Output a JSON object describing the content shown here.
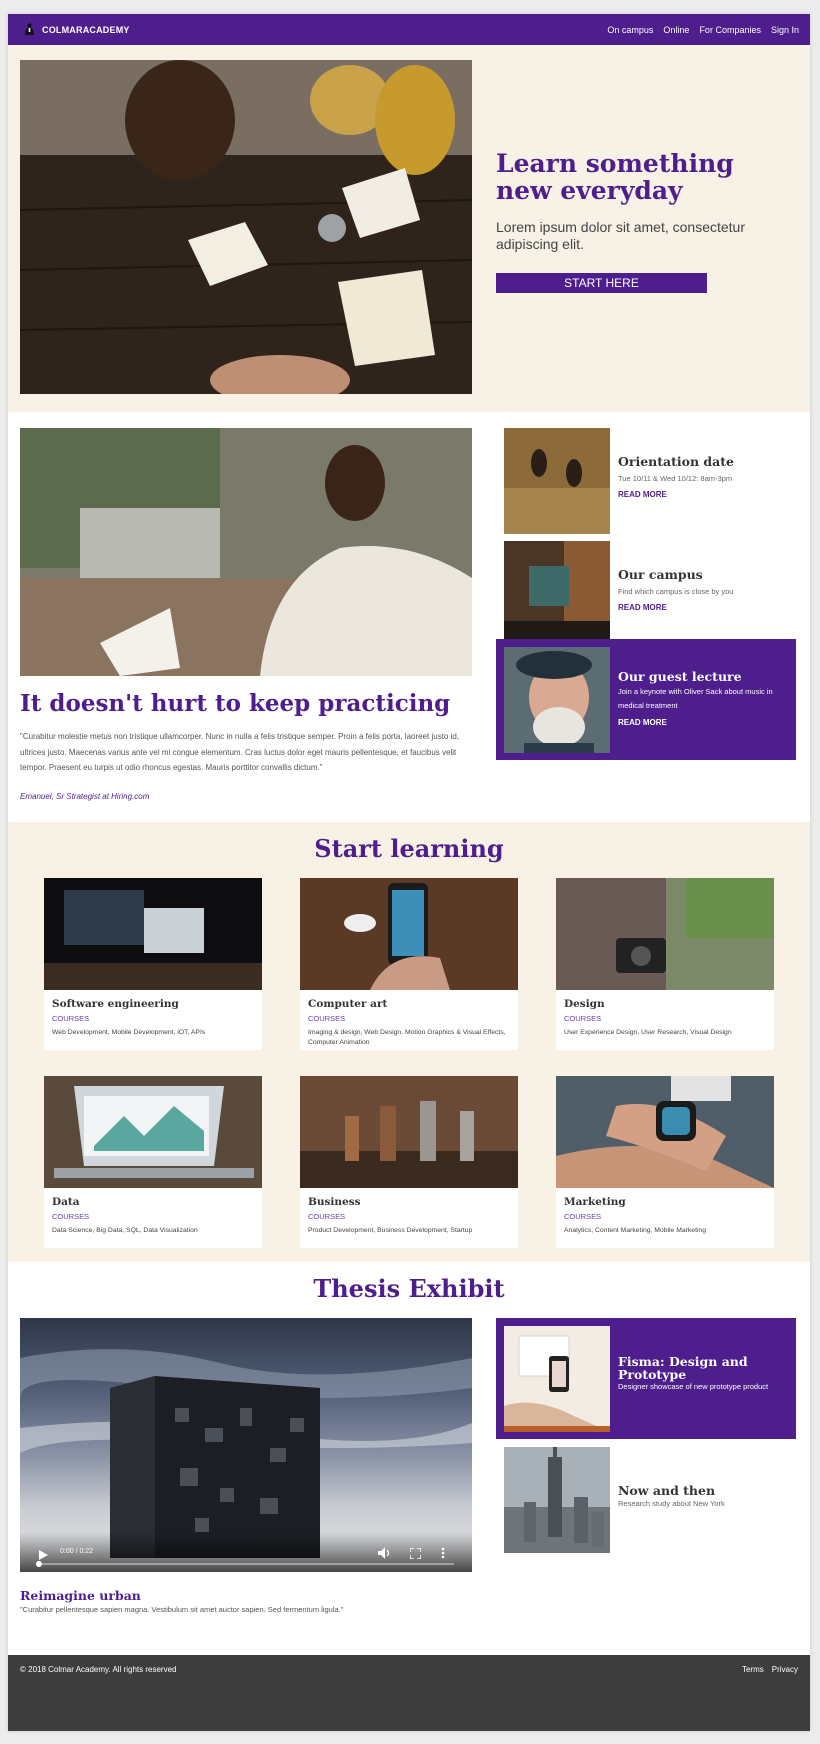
{
  "nav": {
    "brand": "COLMARACADEMY",
    "links": [
      "On campus",
      "Online",
      "For Companies",
      "Sign In"
    ]
  },
  "hero": {
    "title": "Learn something new everyday",
    "subtitle": "Lorem ipsum dolor sit amet, consectetur adipiscing elit.",
    "cta": "START HERE"
  },
  "practice": {
    "title": "It doesn't hurt to keep practicing",
    "quote": "\"Curabitur molestie metus non tristique ullamcorper. Nunc in nulla a felis tristique semper. Proin a felis porta, laoreet justo id, ultrices justo. Maecenas varius ante vel mi congue elementum. Cras luctus dolor eget mauris pellentesque, et faucibus velit tempor. Praesent eu turpis ut odio rhoncus egestas. Mauris porttitor convallis dictum.\"",
    "author": "Emanuel, Sr Strategist at Hiring.com"
  },
  "events": [
    {
      "title": "Orientation date",
      "desc": "Tue 10/11 & Wed 10/12: 8am-3pm",
      "more": "READ MORE"
    },
    {
      "title": "Our campus",
      "desc": "Find which campus is close by you",
      "more": "READ MORE"
    },
    {
      "title": "Our guest lecture",
      "desc": "Join a keynote with Oliver Sack about music in medical treatment",
      "more": "READ MORE"
    }
  ],
  "start_learning": {
    "title": "Start learning",
    "courses": [
      {
        "title": "Software engineering",
        "tag": "COURSES",
        "desc": "Web Development, Mobile Development, iOT, APIs"
      },
      {
        "title": "Computer art",
        "tag": "COURSES",
        "desc": "Imaging & design, Web Design, Motion Graphics & Visual Effects, Computer Animation"
      },
      {
        "title": "Design",
        "tag": "COURSES",
        "desc": "User Experience Design, User Research, Visual Design"
      },
      {
        "title": "Data",
        "tag": "COURSES",
        "desc": "Data Science, Big Data, SQL, Data Visualization"
      },
      {
        "title": "Business",
        "tag": "COURSES",
        "desc": "Product Development, Business Development, Startup"
      },
      {
        "title": "Marketing",
        "tag": "COURSES",
        "desc": "Analytics, Content Marketing, Mobile Marketing"
      }
    ]
  },
  "thesis": {
    "title": "Thesis Exhibit",
    "video_time": "0:00 / 0:22",
    "video_title": "Reimagine urban",
    "video_quote": "\"Curabitur pellentesque sapien magna. Vestibulum sit amet auctor sapien. Sed fermentum ligula.\"",
    "items": [
      {
        "title": "Fisma: Design and Prototype",
        "desc": "Designer showcase of new prototype product"
      },
      {
        "title": "Now and then",
        "desc": "Research study about New York"
      }
    ]
  },
  "footer": {
    "copyright": "© 2018 Colmar Academy. All rights reserved",
    "links": [
      "Terms",
      "Privacy"
    ]
  }
}
